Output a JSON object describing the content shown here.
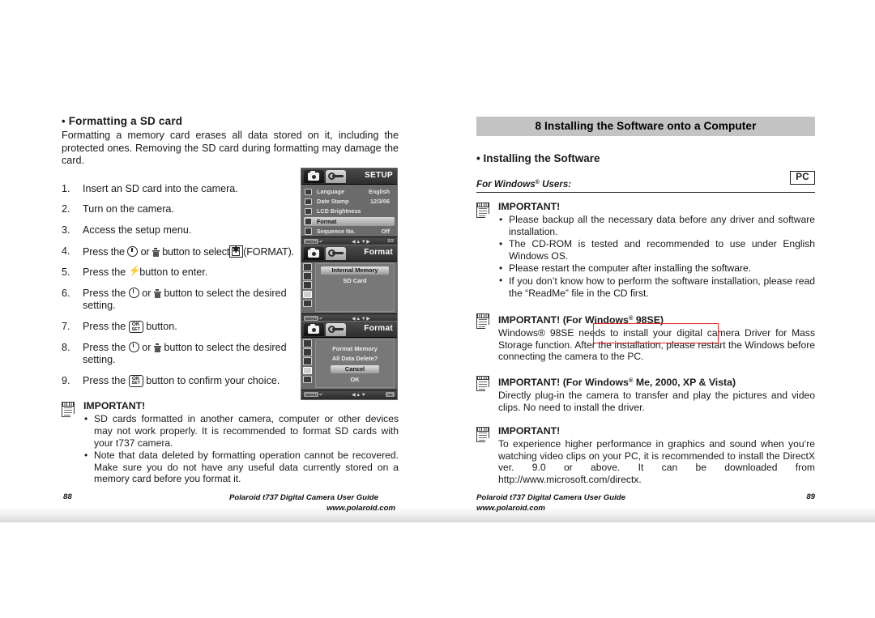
{
  "left_page": {
    "heading": "Formatting a SD card",
    "intro": "Formatting a memory card erases all data stored on it, including the protected ones. Removing the SD card during formatting may damage the card.",
    "steps": [
      {
        "num": "1.",
        "pre": "Insert an SD card into the camera.",
        "post": ""
      },
      {
        "num": "2.",
        "pre": "Turn on the camera.",
        "post": ""
      },
      {
        "num": "3.",
        "pre": "Access the setup menu.",
        "post": ""
      },
      {
        "num": "4.",
        "pre": "Press the",
        "mid": "or",
        "mid2": "button to select",
        "post": "(FORMAT)."
      },
      {
        "num": "5.",
        "pre": "Press the",
        "post": "button to enter."
      },
      {
        "num": "6.",
        "pre": "Press the",
        "mid": "or",
        "post": "button to select the desired setting."
      },
      {
        "num": "7.",
        "pre": "Press the",
        "post": "button."
      },
      {
        "num": "8.",
        "pre": "Press the",
        "mid": "or",
        "post": "button to select the desired setting."
      },
      {
        "num": "9.",
        "pre": "Press the",
        "post": "button to confirm your choice."
      }
    ],
    "note": {
      "title": "IMPORTANT!",
      "items": [
        "SD cards formatted in another camera, computer or other devices may not work properly. It is recommended to format SD cards with your t737 camera.",
        "Note that data deleted by formatting operation cannot be recovered. Make sure you do not have any useful data currently stored on a memory card before you format it."
      ]
    }
  },
  "lcd_screens": [
    {
      "name": "setup-menu",
      "title": "SETUP",
      "rows": [
        {
          "label": "Language",
          "value": "English",
          "selected": false
        },
        {
          "label": "Date Stamp",
          "value": "12/3/06",
          "selected": false
        },
        {
          "label": "LCD Brightness",
          "value": "",
          "selected": false
        },
        {
          "label": "Format",
          "value": "",
          "selected": true
        },
        {
          "label": "Sequence No.",
          "value": "Off",
          "selected": false
        }
      ],
      "bottom": {
        "menu": "MENU",
        "back": "↵",
        "arrows": "◀▲▼▶",
        "page": "2/2"
      }
    },
    {
      "name": "format-target",
      "title": "Format",
      "options": [
        {
          "label": "Internal Memory",
          "selected": true
        },
        {
          "label": "SD Card",
          "selected": false
        }
      ],
      "bottom": {
        "menu": "MENU",
        "back": "↵",
        "arrows": "◀▲▼▶",
        "page": ""
      }
    },
    {
      "name": "format-confirm",
      "title": "Format",
      "messages": [
        "Format Memory",
        "All Data Delete?"
      ],
      "buttons": [
        {
          "label": "Cancel",
          "selected": true
        },
        {
          "label": "OK",
          "selected": false
        }
      ],
      "bottom": {
        "menu": "MENU",
        "back": "↵",
        "arrows": "◀▲▼",
        "ok": "OK"
      }
    }
  ],
  "right_page": {
    "chapter": "8 Installing the Software onto a Computer",
    "heading": "Installing the Software",
    "for_windows": "For Windows",
    "for_windows_sup": "®",
    "for_windows_tail": " Users:",
    "pc_badge": "PC",
    "notes": [
      {
        "title": "IMPORTANT!",
        "title_sup": "",
        "title_tail": "",
        "items": [
          "Please backup all the necessary data before any driver and software installation.",
          "The CD-ROM is tested and recommended to use under English Windows OS.",
          "Please restart the computer after installing the software.",
          "If you don’t know how to perform the software installation, please read the “ReadMe” file in the CD first."
        ],
        "body": ""
      },
      {
        "title": "IMPORTANT! (For Windows",
        "title_sup": "®",
        "title_tail": " 98SE)",
        "items": [],
        "body": "Windows® 98SE needs to install your digital camera Driver for Mass Storage function. After the installation, please restart the Windows before connecting the camera to the PC."
      },
      {
        "title": "IMPORTANT! (For Windows",
        "title_sup": "®",
        "title_tail": " Me, 2000, XP & Vista)",
        "items": [],
        "body": "Directly plug-in the camera to transfer and play the pictures and video clips. No need to install the driver."
      },
      {
        "title": "IMPORTANT!",
        "title_sup": "",
        "title_tail": "",
        "items": [],
        "body": "To experience higher performance in graphics and sound when you‘re watching video clips on your PC, it is recommended to install the DirectX ver. 9.0 or above. It can be downloaded from http://www.microsoft.com/directx."
      }
    ],
    "highlight_color": "#e8232a"
  },
  "footer": {
    "left_page_number": "88",
    "right_page_number": "89",
    "guide": "Polaroid t737 Digital Camera User Guide",
    "url": "www.polaroid.com"
  }
}
